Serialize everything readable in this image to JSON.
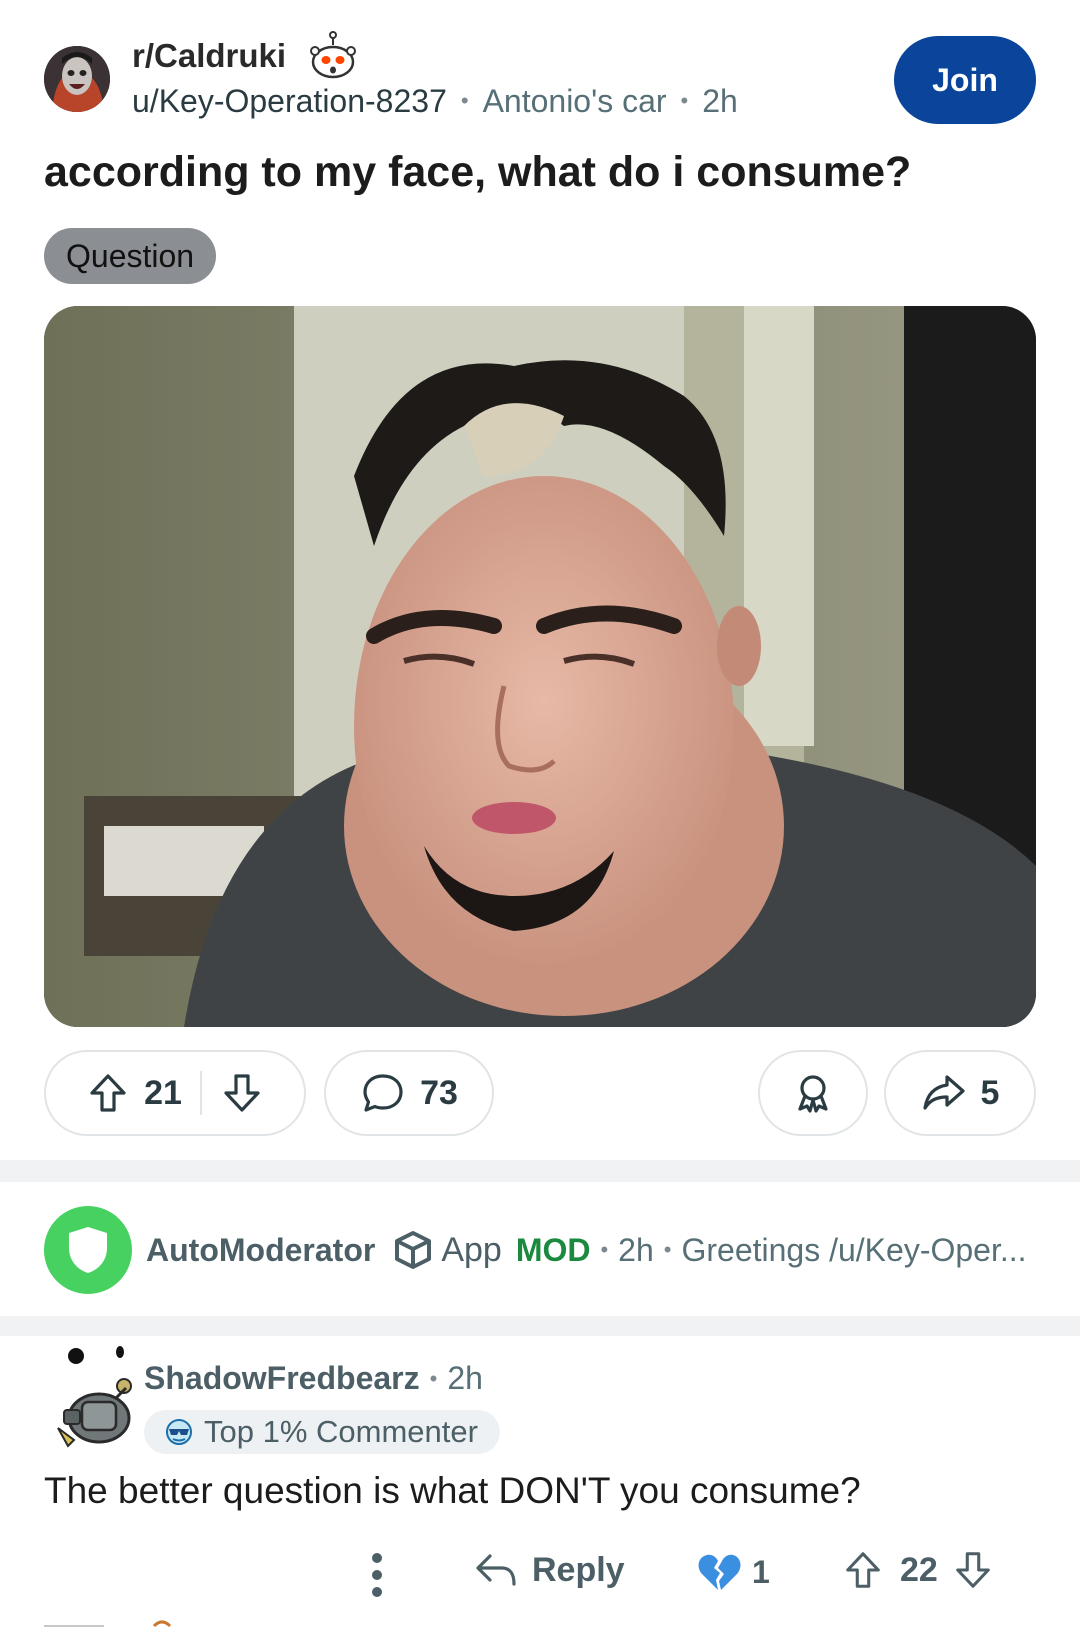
{
  "post": {
    "subreddit": "r/Caldruki",
    "author": "u/Key-Operation-8237",
    "author_flair": "Antonio's car",
    "time": "2h",
    "join_label": "Join",
    "title": "according to my face, what do i consume?",
    "flair": "Question",
    "image_alt": "selfie photo",
    "upvotes": "21",
    "comments": "73",
    "shares": "5"
  },
  "automod": {
    "name": "AutoModerator",
    "app_label": "App",
    "mod_label": "MOD",
    "time": "2h",
    "preview": "Greetings /u/Key-Oper..."
  },
  "comment": {
    "author": "ShadowFredbearz",
    "time": "2h",
    "badge": "Top 1% Commenter",
    "body": "The better question is what DON'T you consume?",
    "reply_label": "Reply",
    "heart_count": "1",
    "votes": "22"
  },
  "colors": {
    "join": "#0a449b",
    "mod_green": "#1b8a3e",
    "automod_avatar": "#46d160",
    "flair_bg": "#8b8f93"
  },
  "icons": [
    "snoo-icon",
    "upvote-icon",
    "downvote-icon",
    "comment-icon",
    "award-icon",
    "share-icon",
    "shield-icon",
    "app-cube-icon",
    "sunglasses-icon",
    "more-icon",
    "reply-icon",
    "broken-heart-icon"
  ]
}
